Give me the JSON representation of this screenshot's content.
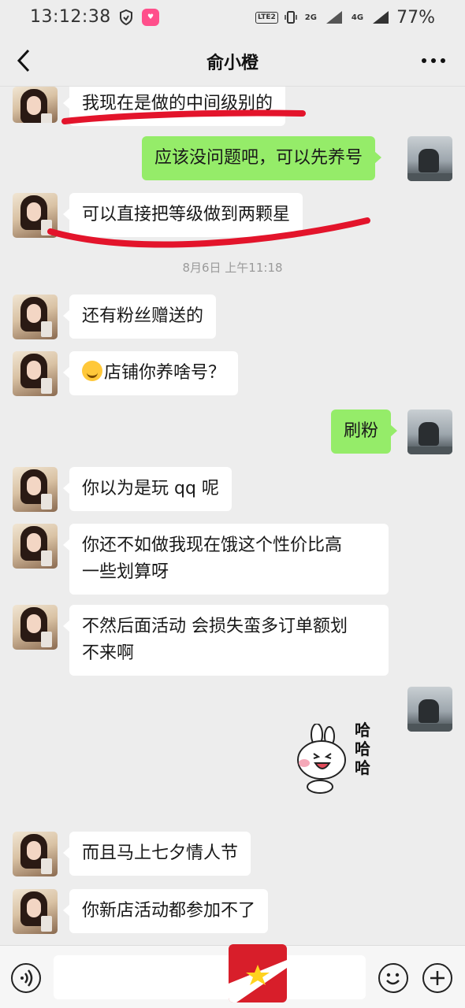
{
  "status_bar": {
    "time": "13:12:38",
    "network_1": "LTE2",
    "network_2": "2G",
    "network_3": "4G",
    "battery": "77%"
  },
  "nav": {
    "title": "俞小橙",
    "back_icon": "chevron-left-icon",
    "more_icon": "more-dots-icon"
  },
  "messages": [
    {
      "side": "left",
      "text": "我现在是做的中间级别的"
    },
    {
      "side": "right",
      "text": "应该没问题吧，可以先养号"
    },
    {
      "side": "left",
      "text": "可以直接把等级做到两颗星"
    },
    {
      "type": "time",
      "text": "8月6日 上午11:18"
    },
    {
      "side": "left",
      "text": "还有粉丝赠送的"
    },
    {
      "side": "left",
      "text": "店铺你养啥号？",
      "emoji": "laughing-tears-emoji"
    },
    {
      "side": "right",
      "text": "刷粉"
    },
    {
      "side": "left",
      "text": "你以为是玩 qq 呢"
    },
    {
      "side": "left",
      "line1": "你还不如做我现在饿这个性价比高",
      "line2": "一些划算呀"
    },
    {
      "side": "left",
      "line1": "不然后面活动 会损失蛮多订单额划",
      "line2": "不来啊"
    },
    {
      "side": "right",
      "type": "sticker",
      "sticker_text": [
        "哈",
        "哈",
        "哈"
      ]
    },
    {
      "side": "left",
      "text": "而且马上七夕情人节"
    },
    {
      "side": "left",
      "text": "你新店活动都参加不了"
    }
  ],
  "input_bar": {
    "voice_icon": "voice-icon",
    "emoji_icon": "emoji-icon",
    "plus_icon": "plus-icon",
    "placeholder": ""
  },
  "colors": {
    "background": "#ededed",
    "my_bubble": "#95ec69",
    "their_bubble": "#ffffff",
    "annotation_red": "#e3142b"
  }
}
